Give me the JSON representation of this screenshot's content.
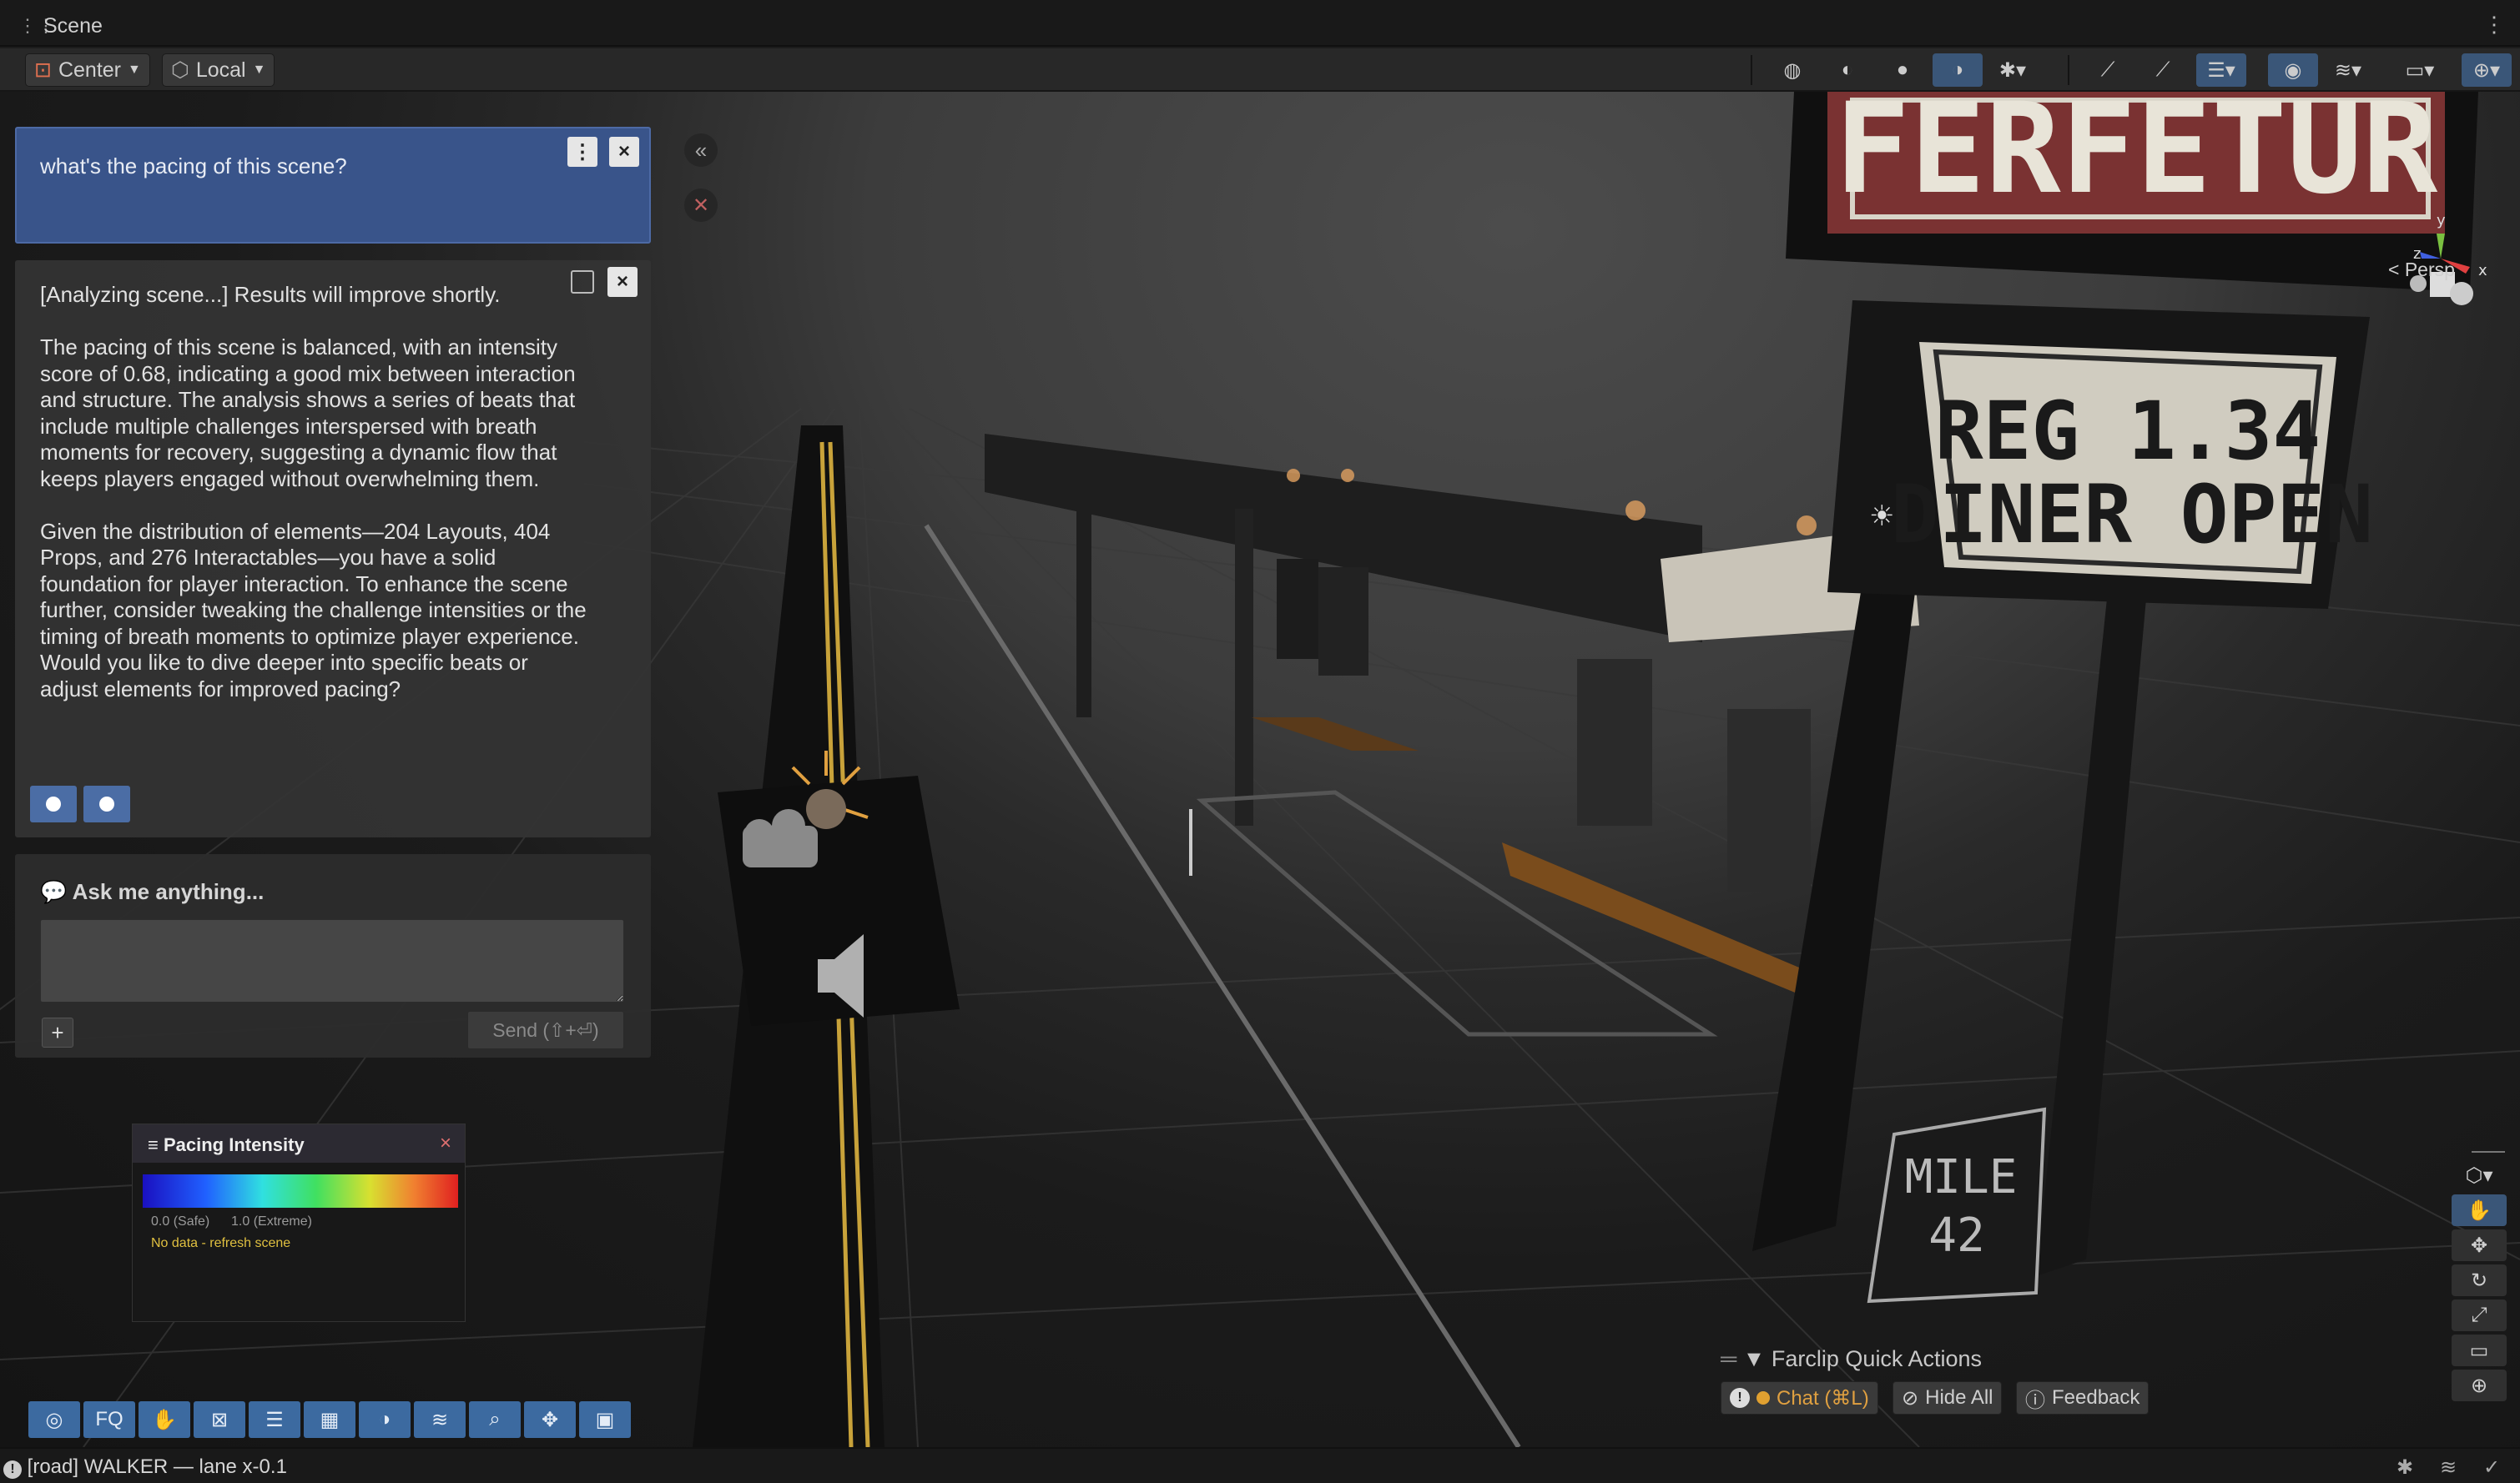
{
  "window": {
    "title": "Scene"
  },
  "toolbar": {
    "pivot": "Center",
    "space": "Local"
  },
  "question": {
    "text": "what's the pacing of this scene?"
  },
  "answer": {
    "text": "[Analyzing scene...] Results will improve shortly.\n\nThe pacing of this scene is balanced, with an intensity score of 0.68, indicating a good mix between interaction and structure. The analysis shows a series of beats that include multiple challenges interspersed with breath moments for recovery, suggesting a dynamic flow that keeps players engaged without overwhelming them.\n\nGiven the distribution of elements—204 Layouts, 404 Props, and 276 Interactables—you have a solid foundation for player interaction. To enhance the scene further, consider tweaking the challenge intensities or the timing of breath moments to optimize player experience. Would you like to dive deeper into specific beats or adjust elements for improved pacing?"
  },
  "chat": {
    "label": "Ask me anything...",
    "value": "",
    "add": "+",
    "send": "Send (⇧+⏎)"
  },
  "collapse": "«",
  "pacing": {
    "title": "Pacing Intensity",
    "low": "0.0 (Safe)",
    "high": "1.0 (Extreme)",
    "status": "No data - refresh scene"
  },
  "gizmo": {
    "y": "y",
    "x": "x",
    "z": "z",
    "view": "Persp"
  },
  "signs": {
    "top": "FERFETUR",
    "reg_line1": "REG  1.34",
    "reg_line2": "DINER OPEN",
    "mile_line1": "MILE",
    "mile_line2": "42"
  },
  "quick_actions": {
    "title": "Farclip Quick Actions",
    "chat": "Chat (⌘L)",
    "hide": "Hide All",
    "feedback": "Feedback"
  },
  "bottom_toolbar": {
    "fq": "FQ"
  },
  "status": {
    "message": "[road] WALKER — lane x-0.1"
  }
}
